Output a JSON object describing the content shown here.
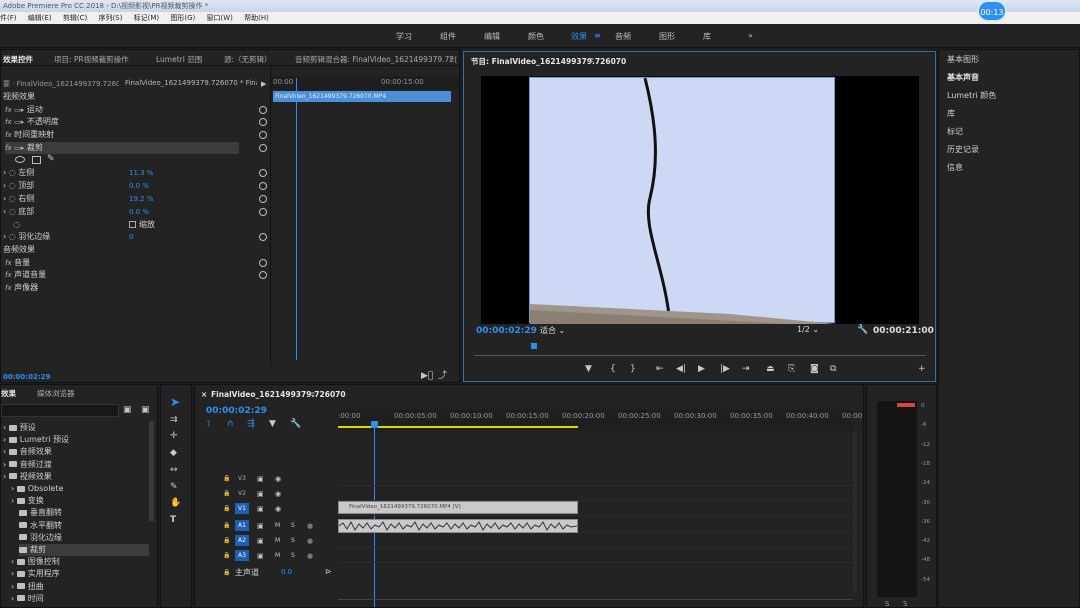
{
  "titlebar": {
    "text": "Adobe Premiere Pro CC 2018 - D:\\视频影视\\PR视频裁剪操作 *",
    "timer": "00:13"
  },
  "menu": [
    "件(F)",
    "编辑(E)",
    "剪辑(C)",
    "序列(S)",
    "标记(M)",
    "图形(G)",
    "窗口(W)",
    "帮助(H)"
  ],
  "workspaces": [
    "学习",
    "组件",
    "编辑",
    "颜色",
    "效果",
    "音频",
    "图形",
    "库"
  ],
  "effect_controls": {
    "tabs": [
      "效果控件",
      "项目: PR视频裁剪操作",
      "Lumetri 范围",
      "源:（无剪辑）",
      "音频剪辑混合器: FinalVideo_1621499379.72("
    ],
    "master": "要 · FinalVideo_1621499379.726070...",
    "clip": "FinalVideo_1621499379.726070 * Fina...",
    "ruler": [
      "00:00",
      "00:00:15:00"
    ],
    "clip_bar": "FinalVideo_1621499379.726070.MP4",
    "video_effects": "视频效果",
    "motion": "运动",
    "opacity": "不透明度",
    "timeremap": "时间重映射",
    "crop": "裁剪",
    "params": [
      {
        "label": "左侧",
        "value": "11.3 %"
      },
      {
        "label": "顶部",
        "value": "0.0 %"
      },
      {
        "label": "右侧",
        "value": "19.2 %"
      },
      {
        "label": "底部",
        "value": "0.0 %"
      }
    ],
    "zoom_label": "缩放",
    "feather": {
      "label": "羽化边缘",
      "value": "0"
    },
    "audio_effects": "音频效果",
    "volume": "音量",
    "channel_volume": "声道音量",
    "panner": "声像器",
    "timecode": "00:00:02:29"
  },
  "program": {
    "title": "节目: FinalVideo_1621499379.726070",
    "timecode": "00:00:02:29",
    "fit": "适合",
    "resolution": "1/2",
    "duration": "00:00:21:00"
  },
  "right_panel": [
    "基本图形",
    "基本声音",
    "Lumetri 颜色",
    "库",
    "标记",
    "历史记录",
    "信息"
  ],
  "effects_panel": {
    "tabs": [
      "效果",
      "媒体浏览器"
    ],
    "tree": [
      {
        "label": "预设",
        "level": 0
      },
      {
        "label": "Lumetri 预设",
        "level": 0
      },
      {
        "label": "音频效果",
        "level": 0
      },
      {
        "label": "音频过渡",
        "level": 0
      },
      {
        "label": "视频效果",
        "level": 0
      },
      {
        "label": "Obsolete",
        "level": 1
      },
      {
        "label": "变换",
        "level": 1
      },
      {
        "label": "垂直翻转",
        "level": 2
      },
      {
        "label": "水平翻转",
        "level": 2
      },
      {
        "label": "羽化边缘",
        "level": 2
      },
      {
        "label": "裁剪",
        "level": 2
      },
      {
        "label": "图像控制",
        "level": 1
      },
      {
        "label": "实用程序",
        "level": 1
      },
      {
        "label": "扭曲",
        "level": 1
      },
      {
        "label": "时间",
        "level": 1
      }
    ]
  },
  "timeline": {
    "tab": "FinalVideo_1621499379.726070",
    "timecode": "00:00:02:29",
    "ruler": [
      ":00:00",
      "00:00:05:00",
      "00:00:10:00",
      "00:00:15:00",
      "00:00:20:00",
      "00:00:25:00",
      "00:00:30:00",
      "00:00:35:00",
      "00:00:40:00",
      "00:00:"
    ],
    "video_tracks": [
      "V3",
      "V2",
      "V1"
    ],
    "audio_tracks": [
      "A1",
      "A2",
      "A3"
    ],
    "master": "主声道",
    "master_value": "0.0",
    "clip_video": "FinalVideo_1621499379.726070.MP4 [V]",
    "clip_audio": ""
  },
  "meter": {
    "labels": [
      "0",
      "-6",
      "-12",
      "-18",
      "-24",
      "-30",
      "-36",
      "-42",
      "-48",
      "-54"
    ],
    "bottom": [
      "S",
      "S"
    ]
  },
  "colors": {
    "accent": "#2f8ff0",
    "clip_video": "#c9c9c9",
    "playhead": "#2f8ff0"
  }
}
